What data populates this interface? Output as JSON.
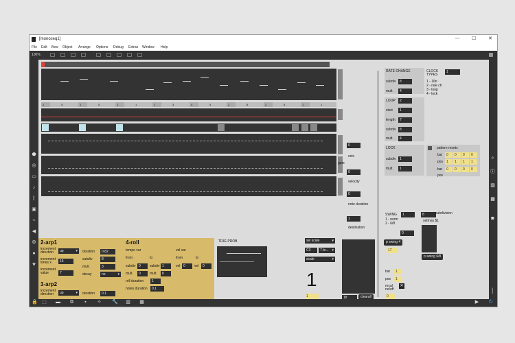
{
  "window": {
    "title": "[monoseq1]",
    "min": "—",
    "max": "☐",
    "close": "✕"
  },
  "menu": [
    "File",
    "Edit",
    "View",
    "Object",
    "Arrange",
    "Options",
    "Debug",
    "Extras",
    "Window",
    "Help"
  ],
  "toolbar": {
    "zoom": "100%"
  },
  "step_values": [
    "1",
    "5",
    "1",
    "5",
    "1",
    "1",
    "1",
    "3",
    "4",
    "5",
    "2",
    "8",
    "2",
    "5",
    "1",
    "1"
  ],
  "side": {
    "octv": "octv",
    "octv_val": "0",
    "gate": "gate",
    "velocity": "velocity",
    "velocity_val": "0",
    "note_duration": "note duration",
    "note_duration_val": "0",
    "destination": "destination",
    "destination_val": "1"
  },
  "arp1": {
    "title": "2-arp1",
    "inc_dir": "increment direction",
    "inc_dir_val": "up",
    "inc_times": "increment times x",
    "inc_times_val": "16",
    "inc_val": "increment value",
    "inc_val_val": "7",
    "duration": "duration",
    "duration_val": "0.82",
    "subdiv": "subdiv",
    "subdiv_val": "8",
    "mult": "mult.",
    "mult_val": "3",
    "decay": "decay",
    "decay_val": "no"
  },
  "arp2": {
    "title": "3-arp2",
    "inc_dir": "increment direction",
    "inc_dir_val": "up",
    "inc_times": "increment times x",
    "inc_times_val": "0",
    "inc_val": "increment value",
    "inc_val_val": "0",
    "duration": "duration",
    "duration_val": "0.1",
    "subdiv": "subdiv",
    "subdiv_val": "0",
    "mult": "mult.",
    "mult_val": "0",
    "decay": "decay",
    "decay_val": "no"
  },
  "roll": {
    "title": "4-roll",
    "tempo_var": "tempo var",
    "vel_var": "vel var",
    "from": "from",
    "to": "to",
    "subdiv": "subdiv",
    "mult": "mult.",
    "vel": "vel",
    "subdiv_from": "0",
    "subdiv_to": "1",
    "mult_from": "0",
    "mult_to": "0",
    "vel_from": "0",
    "vel_to": "0",
    "roll_duration": "roll duration",
    "roll_duration_val": "1",
    "notes_duration": "notes duration",
    "notes_duration_val": "0.1"
  },
  "trig": {
    "title": "TRIG PROB",
    "sel_scale": "sel scale",
    "note": "C3",
    "mode": "7-lo...",
    "scale": "scale",
    "big_number": "1",
    "notes_destin_val": "1",
    "notes_destin": "NOTES destin",
    "num18": "18",
    "clearall": "clearall",
    "prepend": "prepend store",
    "store": "store 18"
  },
  "rate": {
    "title": "RATE CHANGE",
    "subdiv": "subdiv",
    "subdiv_val": "8",
    "mult": "mult.",
    "mult_val": "4",
    "clock_types": "CLOCK TYPES",
    "clock_val": "1",
    "ct1": "1 - 16n",
    "ct2": "2 - rate ch",
    "ct3": "3 - loop",
    "ct4": "4 - lock"
  },
  "loop": {
    "title": "LOOP",
    "start": "start",
    "start_val": "1",
    "length": "length",
    "length_val": "7",
    "subdiv": "subdiv",
    "subdiv_val": "8",
    "mult": "mult.",
    "mult_val": "4",
    "top_val": "2"
  },
  "lock": {
    "title": "LOCK",
    "subdiv": "subdiv",
    "subdiv_val": "1",
    "mult": "mult.",
    "mult_val": "1",
    "pattern_resets": "pattern resets",
    "bar": "bar",
    "pos": "pos",
    "bar_vals1": [
      "0",
      "0",
      "0",
      "0"
    ],
    "pos_vals1": [
      "1",
      "1",
      "1",
      "1"
    ],
    "bar_vals2": [
      "0",
      "0",
      "0",
      "0"
    ],
    "pos_vals2": [
      "1",
      "1",
      "1",
      "1"
    ]
  },
  "swing": {
    "title": "SWING",
    "val": "1",
    "norm": "1 - norm",
    "six8": "2 - 6/8",
    "subdivision": "subdivision",
    "sub_val": "8",
    "setmax": "setmax $1",
    "num0": "0",
    "p_swing4": "p swing 4",
    "num17": "17",
    "p_swing68": "p swing 6/8"
  },
  "recall": {
    "bar": "bar",
    "bar_val": "1",
    "pos": "pos",
    "pos_val": "1",
    "recall": "recal no/off",
    "recall_val": "0"
  },
  "colors": {
    "tan": "#d7ba6a",
    "dark": "#333333",
    "yellow": "#f0e08a",
    "red": "#e0423a",
    "cyan": "#bfe3e8"
  },
  "icons": [
    "lock-icon",
    "pointer-icon",
    "present-icon",
    "copy-icon",
    "grid-icon",
    "wrench-icon",
    "keyboard-icon",
    "play-icon",
    "power-icon"
  ]
}
